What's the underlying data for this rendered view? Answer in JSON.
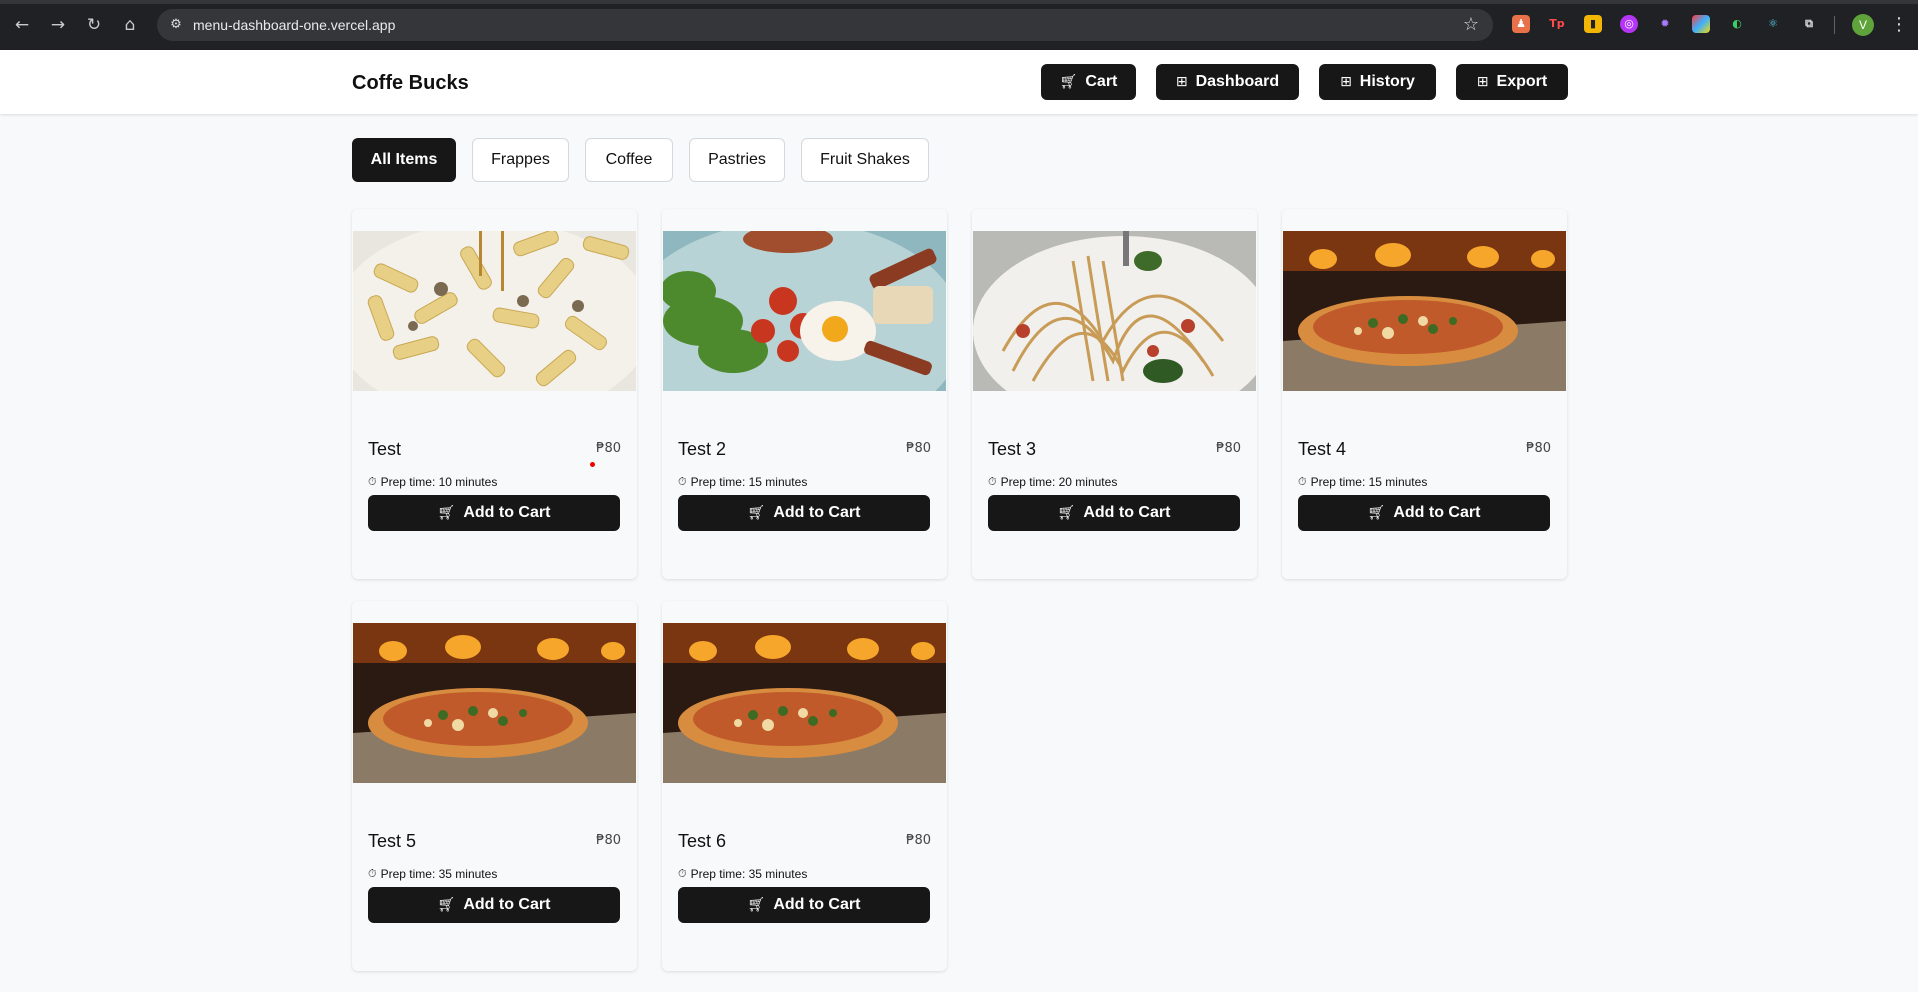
{
  "browser": {
    "url": "menu-dashboard-one.vercel.app",
    "avatar_initial": "V",
    "extensions": [
      "extension-icon-1",
      "extension-icon-2",
      "extension-icon-3",
      "extension-icon-4",
      "extension-icon-5",
      "extension-icon-6",
      "extension-icon-7",
      "extension-icon-8",
      "puzzle-icon"
    ]
  },
  "header": {
    "brand": "Coffe Bucks",
    "cart_label": "Cart",
    "dashboard_label": "Dashboard",
    "history_label": "History",
    "export_label": "Export"
  },
  "filters": [
    {
      "label": "All Items",
      "active": true
    },
    {
      "label": "Frappes",
      "active": false
    },
    {
      "label": "Coffee",
      "active": false
    },
    {
      "label": "Pastries",
      "active": false
    },
    {
      "label": "Fruit Shakes",
      "active": false
    }
  ],
  "products": [
    {
      "name": "Test",
      "price": "₱80",
      "prep": "Prep time: 10 minutes",
      "button": "Add to Cart",
      "image": "penne-pasta"
    },
    {
      "name": "Test 2",
      "price": "₱80",
      "prep": "Prep time: 15 minutes",
      "button": "Add to Cart",
      "image": "breakfast-plate"
    },
    {
      "name": "Test 3",
      "price": "₱80",
      "prep": "Prep time: 20 minutes",
      "button": "Add to Cart",
      "image": "spaghetti"
    },
    {
      "name": "Test 4",
      "price": "₱80",
      "prep": "Prep time: 15 minutes",
      "button": "Add to Cart",
      "image": "pizza"
    },
    {
      "name": "Test 5",
      "price": "₱80",
      "prep": "Prep time: 35 minutes",
      "button": "Add to Cart",
      "image": "pizza"
    },
    {
      "name": "Test 6",
      "price": "₱80",
      "prep": "Prep time: 35 minutes",
      "button": "Add to Cart",
      "image": "pizza"
    }
  ]
}
